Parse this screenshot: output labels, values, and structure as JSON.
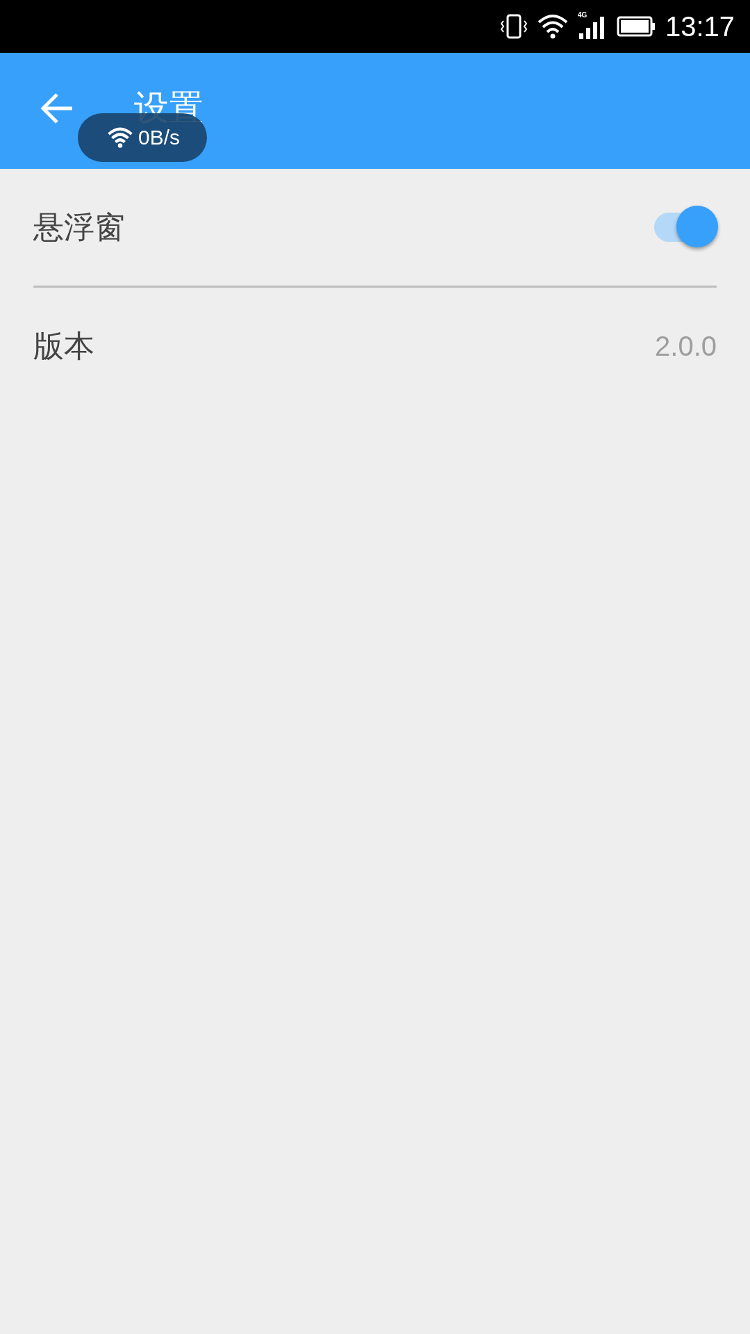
{
  "status_bar": {
    "network": "4G",
    "time": "13:17"
  },
  "app_bar": {
    "title": "设置"
  },
  "floating_window": {
    "speed": "0B/s"
  },
  "settings": [
    {
      "kind": "toggle",
      "label": "悬浮窗",
      "on": true
    },
    {
      "kind": "value",
      "label": "版本",
      "value": "2.0.0"
    }
  ]
}
